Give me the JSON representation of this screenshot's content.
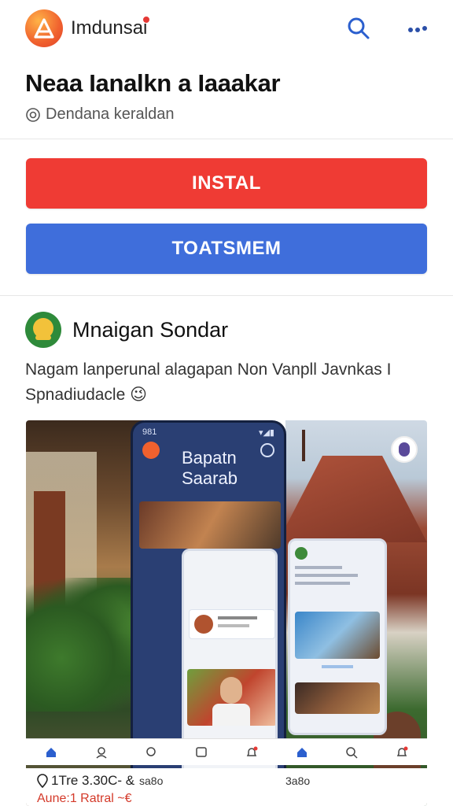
{
  "header": {
    "app_name": "Imdunsai",
    "icons": {
      "logo": "app-logo-icon",
      "search": "search-icon",
      "more": "more-dots-icon"
    }
  },
  "app_info": {
    "title": "Neaa Ianalkn a Iaaakar",
    "subtitle": "Dendana keraldan",
    "subtitle_icon": "badge-icon"
  },
  "actions": {
    "install_label": "INSTAL",
    "secondary_label": "TOATSMEM"
  },
  "developer": {
    "name": "Mnaigan Sondar",
    "avatar_icon": "developer-avatar-icon"
  },
  "description": {
    "text": "Nagam lanperunal alagapan Non Vanpll Javnkas I Spnadiudacle 😉"
  },
  "screenshot": {
    "phone_status_left": "981",
    "phone_status_right": "▾◢▮",
    "phone_title_line1": "Bapatn",
    "phone_title_line2": "Saarab",
    "nav_labels": [
      "",
      "",
      "",
      "",
      "",
      "",
      "",
      "",
      ""
    ],
    "caption_left": "1Tre 3.30C- &",
    "caption_mid": "sa8o",
    "caption_right": "3a8o",
    "caption_bottom": "Aune:1 Ratral ~€"
  },
  "colors": {
    "install": "#ef3b34",
    "secondary": "#3f6edb",
    "accent_search": "#2b5fce",
    "caption_red": "#d43a2a"
  }
}
